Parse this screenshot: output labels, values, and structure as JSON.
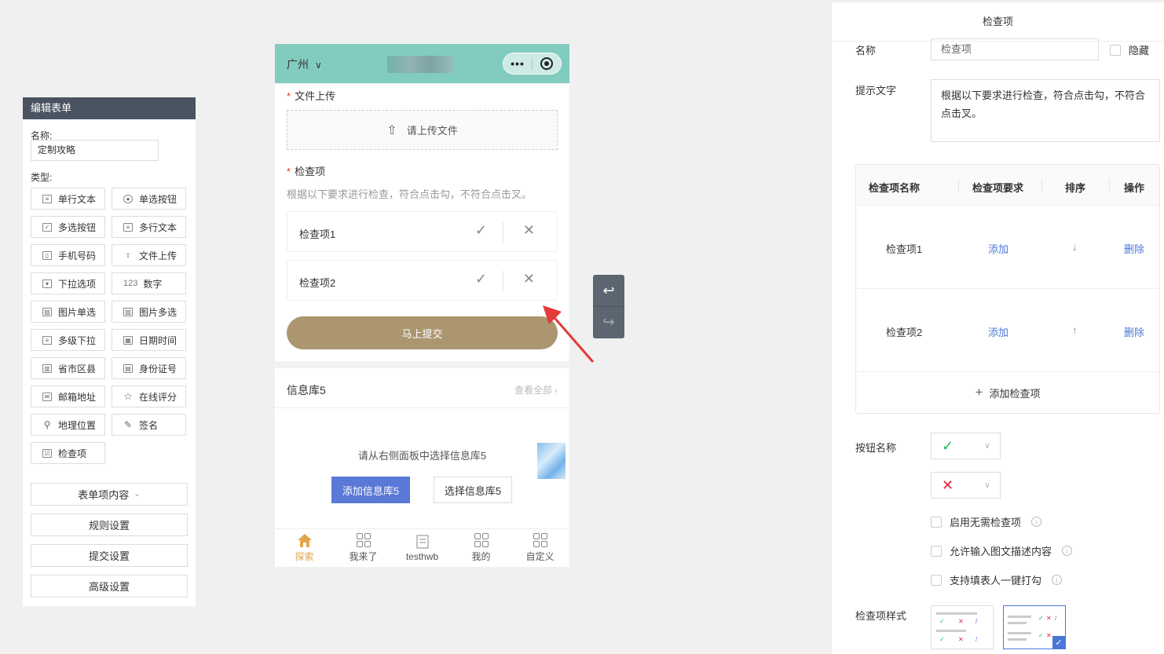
{
  "left_panel": {
    "title": "编辑表单",
    "name_label": "名称:",
    "name_value": "定制攻略",
    "type_label": "类型:",
    "types": [
      {
        "label": "单行文本",
        "icon": "single-line-text-icon"
      },
      {
        "label": "单选按钮",
        "icon": "radio-icon"
      },
      {
        "label": "多选按钮",
        "icon": "checkbox-icon"
      },
      {
        "label": "多行文本",
        "icon": "multi-line-text-icon"
      },
      {
        "label": "手机号码",
        "icon": "phone-icon"
      },
      {
        "label": "文件上传",
        "icon": "upload-icon"
      },
      {
        "label": "下拉选项",
        "icon": "dropdown-icon"
      },
      {
        "label": "数字",
        "icon": "number-icon",
        "glyph": "123"
      },
      {
        "label": "图片单选",
        "icon": "image-single-icon"
      },
      {
        "label": "图片多选",
        "icon": "image-multi-icon"
      },
      {
        "label": "多级下拉",
        "icon": "cascade-icon"
      },
      {
        "label": "日期时间",
        "icon": "calendar-icon"
      },
      {
        "label": "省市区县",
        "icon": "building-icon"
      },
      {
        "label": "身份证号",
        "icon": "id-card-icon"
      },
      {
        "label": "邮箱地址",
        "icon": "mail-icon"
      },
      {
        "label": "在线评分",
        "icon": "star-icon"
      },
      {
        "label": "地理位置",
        "icon": "location-icon"
      },
      {
        "label": "签名",
        "icon": "signature-icon"
      },
      {
        "label": "检查项",
        "icon": "checklist-icon"
      }
    ],
    "sections": [
      "表单项内容",
      "规则设置",
      "提交设置",
      "高级设置"
    ]
  },
  "phone": {
    "city": "广州",
    "upload_label": "文件上传",
    "upload_button": "请上传文件",
    "check_label": "检查项",
    "check_hint": "根据以下要求进行检查，符合点击勾，不符合点击叉。",
    "check_items": [
      "检查项1",
      "检查项2"
    ],
    "submit": "马上提交",
    "library_title": "信息库5",
    "view_all": "查看全部",
    "library_hint": "请从右侧面板中选择信息库5",
    "library_add": "添加信息库5",
    "library_choose": "选择信息库5",
    "tabs": [
      {
        "label": "探索",
        "icon": "home-icon",
        "active": true
      },
      {
        "label": "我来了",
        "icon": "grid-icon"
      },
      {
        "label": "testhwb",
        "icon": "document-icon"
      },
      {
        "label": "我的",
        "icon": "grid-icon"
      },
      {
        "label": "自定义",
        "icon": "grid-icon"
      }
    ]
  },
  "right_panel": {
    "title": "检查项",
    "name_label": "名称",
    "name_value": "检查项",
    "hidden_label": "隐藏",
    "hint_label": "提示文字",
    "hint_value": "根据以下要求进行检查，符合点击勾，不符合点击叉。",
    "table": {
      "headers": [
        "检查项名称",
        "检查项要求",
        "排序",
        "操作"
      ],
      "rows": [
        {
          "name": "检查项1",
          "requirement": "添加",
          "sort": "↓",
          "action": "删除"
        },
        {
          "name": "检查项2",
          "requirement": "添加",
          "sort": "↑",
          "action": "删除"
        }
      ],
      "add_label": "添加检查项"
    },
    "button_name_label": "按钮名称",
    "options": [
      "启用无需检查项",
      "允许输入图文描述内容",
      "支持填表人一键打勾"
    ],
    "style_label": "检查项样式"
  },
  "colors": {
    "header_bar": "#82cbbf",
    "submit": "#ab9670",
    "primary": "#5a79d6",
    "check_green": "#19b955",
    "cross_red": "#e0223a",
    "tab_active": "#e3a54b"
  }
}
